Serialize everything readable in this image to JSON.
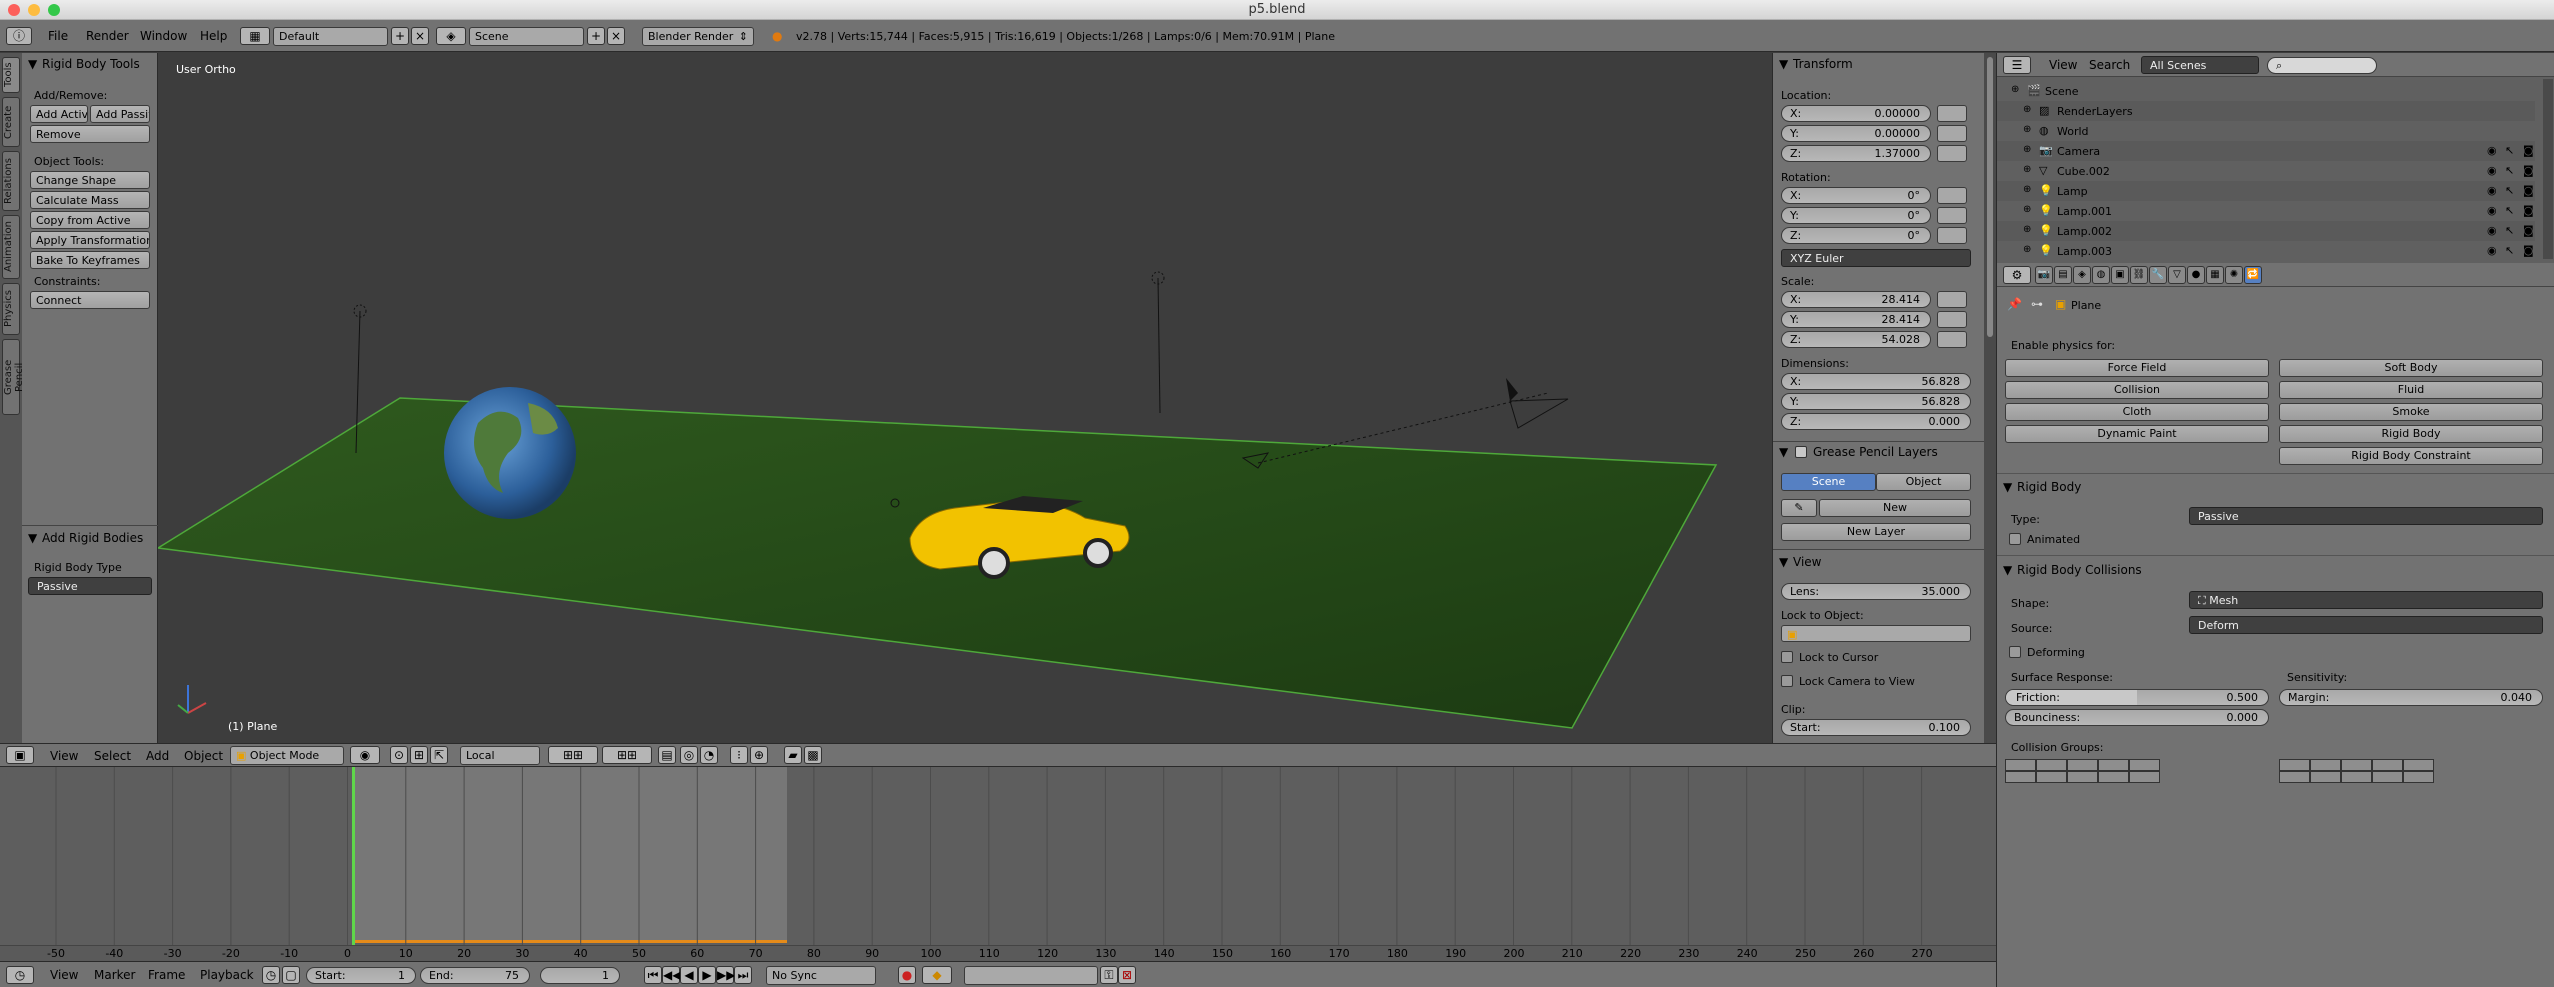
{
  "window": {
    "title": "p5.blend"
  },
  "infobar": {
    "menu": [
      "File",
      "Render",
      "Window",
      "Help"
    ],
    "layout": "Default",
    "scene": "Scene",
    "engine": "Blender Render",
    "stats": "v2.78 | Verts:15,744 | Faces:5,915 | Tris:16,619 | Objects:1/268 | Lamps:0/6 | Mem:70.91M | Plane"
  },
  "lefttabs": [
    "Tools",
    "Create",
    "Relations",
    "Animation",
    "Physics",
    "Grease Pencil"
  ],
  "toolshelf": {
    "title": "Rigid Body Tools",
    "add_remove": "Add/Remove:",
    "add_active": "Add Activ",
    "add_passive": "Add Passiv",
    "remove": "Remove",
    "object_tools": "Object Tools:",
    "change_shape": "Change Shape",
    "calc_mass": "Calculate Mass",
    "copy_active": "Copy from Active",
    "apply_transform": "Apply Transformation",
    "bake": "Bake To Keyframes",
    "constraints": "Constraints:",
    "connect": "Connect",
    "add_rb_title": "Add Rigid Bodies",
    "rb_type_label": "Rigid Body Type",
    "rb_type": "Passive"
  },
  "viewport": {
    "view_name": "User Ortho",
    "object_label": "(1) Plane"
  },
  "npanel": {
    "transform": "Transform",
    "location": "Location:",
    "loc": {
      "x": "0.00000",
      "y": "0.00000",
      "z": "1.37000"
    },
    "rotation": "Rotation:",
    "rot": {
      "x": "0°",
      "y": "0°",
      "z": "0°"
    },
    "euler": "XYZ Euler",
    "scale": "Scale:",
    "scl": {
      "x": "28.414",
      "y": "28.414",
      "z": "54.028"
    },
    "dimensions": "Dimensions:",
    "dim": {
      "x": "56.828",
      "y": "56.828",
      "z": "0.000"
    },
    "gp_layers": "Grease Pencil Layers",
    "gp_scene": "Scene",
    "gp_object": "Object",
    "gp_new": "New",
    "gp_new_layer": "New Layer",
    "view": "View",
    "lens_label": "Lens:",
    "lens": "35.000",
    "lock_obj": "Lock to Object:",
    "lock_cursor": "Lock to Cursor",
    "lock_camera": "Lock Camera to View",
    "clip": "Clip:",
    "clip_start_label": "Start:",
    "clip_start": "0.100",
    "ax": {
      "x": "X:",
      "y": "Y:",
      "z": "Z:"
    }
  },
  "vpheader": {
    "menu": [
      "View",
      "Select",
      "Add",
      "Object"
    ],
    "mode": "Object Mode",
    "orientation": "Local"
  },
  "timeline": {
    "ticks": [
      "-50",
      "-40",
      "-30",
      "-20",
      "-10",
      "0",
      "10",
      "20",
      "30",
      "40",
      "50",
      "60",
      "70",
      "80",
      "90",
      "100",
      "110",
      "120",
      "130",
      "140",
      "150",
      "160",
      "170",
      "180",
      "190",
      "200",
      "210",
      "220",
      "230",
      "240",
      "250",
      "260",
      "270"
    ],
    "current_frame": 1,
    "start": 1,
    "end": 75
  },
  "tlheader": {
    "menu": [
      "View",
      "Marker",
      "Frame",
      "Playback"
    ],
    "start_label": "Start:",
    "start": "1",
    "end_label": "End:",
    "end": "75",
    "frame": "1",
    "sync": "No Sync"
  },
  "outliner": {
    "menu": [
      "View",
      "Search"
    ],
    "filter": "All Scenes",
    "items": [
      "Scene",
      "RenderLayers",
      "World",
      "Camera",
      "Cube.002",
      "Lamp",
      "Lamp.001",
      "Lamp.002",
      "Lamp.003"
    ]
  },
  "props": {
    "object": "Plane",
    "enable_physics": "Enable physics for:",
    "physics_buttons": [
      "Force Field",
      "Soft Body",
      "Collision",
      "Fluid",
      "Cloth",
      "Smoke",
      "Dynamic Paint",
      "Rigid Body",
      "",
      "Rigid Body Constraint"
    ],
    "rigid_body": "Rigid Body",
    "type_label": "Type:",
    "type": "Passive",
    "animated": "Animated",
    "collisions": "Rigid Body Collisions",
    "shape_label": "Shape:",
    "shape": "Mesh",
    "source_label": "Source:",
    "source": "Deform",
    "deforming": "Deforming",
    "surface_response": "Surface Response:",
    "sensitivity": "Sensitivity:",
    "friction_label": "Friction:",
    "friction": "0.500",
    "friction_fill": 0.5,
    "bounciness_label": "Bounciness:",
    "bounciness": "0.000",
    "margin_label": "Margin:",
    "margin": "0.040",
    "collision_groups": "Collision Groups:"
  }
}
